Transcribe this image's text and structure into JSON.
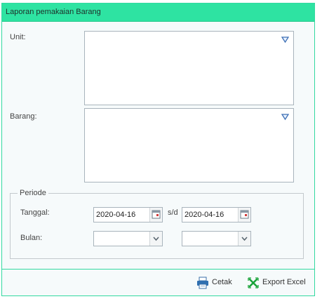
{
  "panel": {
    "title": "Laporan pemakaian Barang"
  },
  "form": {
    "unit_label": "Unit:",
    "barang_label": "Barang:",
    "periode": {
      "legend": "Periode",
      "tanggal_label": "Tanggal:",
      "date_from": "2020-04-16",
      "separator": "s/d",
      "date_to": "2020-04-16",
      "bulan_label": "Bulan:",
      "bulan_from": "",
      "bulan_to": ""
    }
  },
  "footer": {
    "cetak_label": "Cetak",
    "export_label": "Export Excel"
  },
  "icons": {
    "unit_dropdown": "triangle-down-icon",
    "barang_dropdown": "triangle-down-icon",
    "calendar": "calendar-icon",
    "combo_arrow": "chevron-down-icon",
    "cetak": "printer-icon",
    "export": "excel-export-icon"
  },
  "colors": {
    "header": "#2ee3a2",
    "border": "#32d9a0",
    "body": "#f6fafb"
  }
}
